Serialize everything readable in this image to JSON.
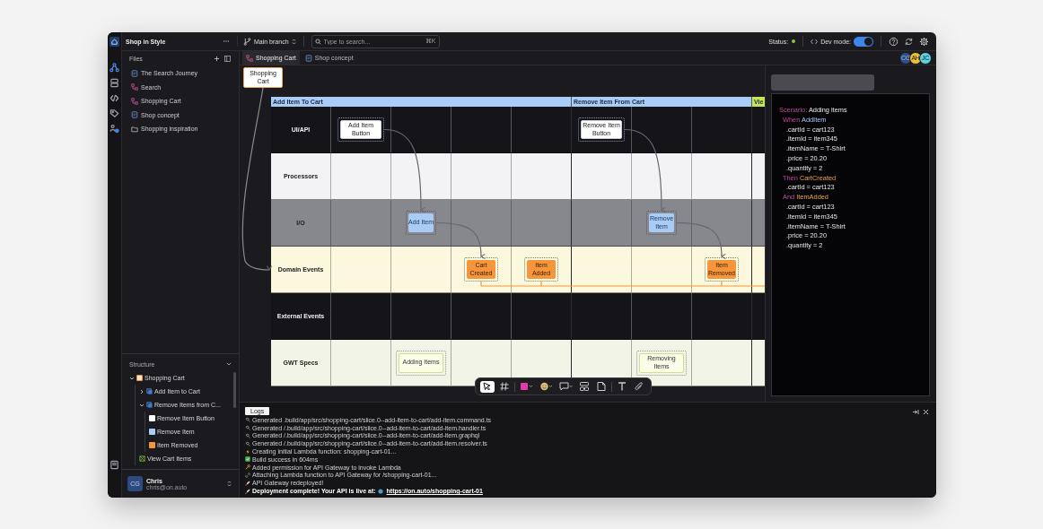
{
  "rail": [
    {
      "kind": "flow",
      "selected": true
    },
    {
      "kind": "database",
      "selected": false
    },
    {
      "kind": "code",
      "selected": false
    },
    {
      "kind": "tags",
      "selected": false
    },
    {
      "kind": "people",
      "selected": false
    },
    {
      "kind": "book",
      "selected": false
    }
  ],
  "project": {
    "name": "Shop in Style"
  },
  "branch": {
    "label": "Main branch"
  },
  "search": {
    "placeholder": "Type to search...",
    "shortcut": "⌘K"
  },
  "status": {
    "label": "Status:",
    "ok": true
  },
  "dev_mode": {
    "label": "Dev mode:",
    "on": true
  },
  "files": {
    "title": "Files",
    "items": [
      {
        "label": "The Search Journey",
        "kind": "doc"
      },
      {
        "label": "Search",
        "kind": "flow"
      },
      {
        "label": "Shopping Cart",
        "kind": "flow"
      },
      {
        "label": "Shop concept",
        "kind": "doc"
      },
      {
        "label": "Shopping inspiration",
        "kind": "folder"
      }
    ]
  },
  "structure": {
    "title": "Structure",
    "tree": [
      {
        "label": "Shopping Cart",
        "kind": "board",
        "expanded": true,
        "children": [
          {
            "label": "Add Item to Cart",
            "kind": "slice",
            "expanded": false
          },
          {
            "label": "Remove Items from C...",
            "kind": "slice",
            "expanded": true,
            "children": [
              {
                "label": "Remove Item Button",
                "kind": "ui"
              },
              {
                "label": "Remove Item",
                "kind": "io"
              },
              {
                "label": "Item Removed",
                "kind": "event"
              }
            ]
          },
          {
            "label": "View Cart Items",
            "kind": "view"
          }
        ]
      }
    ]
  },
  "user": {
    "initials": "CG",
    "name": "Chris",
    "email": "chris@on.auto"
  },
  "tabs": [
    {
      "label": "Shopping Cart",
      "kind": "flow",
      "selected": true
    },
    {
      "label": "Shop concept",
      "kind": "doc",
      "selected": false
    }
  ],
  "collaborators": [
    {
      "initials": "CG",
      "color": "#2f4f86"
    },
    {
      "initials": "AH",
      "color": "#f2c12e"
    },
    {
      "initials": "JC",
      "color": "#5fd3e6"
    }
  ],
  "note": {
    "text": "Shopping Cart"
  },
  "board": {
    "lanes": [
      {
        "label": "UI/API",
        "kind": "ui"
      },
      {
        "label": "Processors",
        "kind": "processor"
      },
      {
        "label": "I/O",
        "kind": "io"
      },
      {
        "label": "Domain Events",
        "kind": "event"
      },
      {
        "label": "External Events",
        "kind": "external"
      },
      {
        "label": "GWT Specs",
        "kind": "spec"
      }
    ],
    "slices": [
      {
        "title": "Add Item To Cart",
        "color": "#a9cdf6",
        "columns": [
          [
            {
              "label": "Add Item Button",
              "kind": "ui"
            }
          ],
          [
            {
              "label": "Add Item",
              "kind": "io"
            },
            {
              "label": "Adding Items",
              "kind": "spec"
            }
          ],
          [
            {
              "label": "Cart Created",
              "kind": "event"
            }
          ],
          [
            {
              "label": "Item Added",
              "kind": "event"
            }
          ]
        ]
      },
      {
        "title": "Remove Item From Cart",
        "color": "#a9cdf6",
        "columns": [
          [
            {
              "label": "Remove Item Button",
              "kind": "ui"
            }
          ],
          [
            {
              "label": "Remove Item",
              "kind": "io"
            },
            {
              "label": "Removing Items",
              "kind": "spec"
            }
          ],
          [
            {
              "label": "Item Removed",
              "kind": "event"
            }
          ]
        ]
      },
      {
        "title": "Vie",
        "color": "#c6e65a"
      }
    ]
  },
  "toolbar": [
    {
      "kind": "pointer",
      "selected": true
    },
    {
      "kind": "hash",
      "selected": false
    },
    {
      "kind": "color",
      "selected": false
    },
    {
      "kind": "face",
      "selected": false
    },
    {
      "kind": "comment",
      "selected": false
    },
    {
      "kind": "layout",
      "selected": false
    },
    {
      "kind": "page",
      "selected": false
    },
    {
      "kind": "text",
      "selected": false
    },
    {
      "kind": "clip",
      "selected": false
    }
  ],
  "spec_panel": {
    "lines": [
      {
        "kind": "scenario",
        "keyword": "Scenario:",
        "text": "Adding items"
      },
      {
        "kind": "when",
        "keyword": "When",
        "text": "AddItem"
      },
      {
        "kind": "field",
        "text": ".cartId = cart123"
      },
      {
        "kind": "field",
        "text": ".itemId = item345"
      },
      {
        "kind": "field",
        "text": ".itemName = T-Shirt"
      },
      {
        "kind": "field",
        "text": ".price = 20.20"
      },
      {
        "kind": "field",
        "text": ".quantity = 2"
      },
      {
        "kind": "then",
        "keyword": "Then",
        "text": "CartCreated"
      },
      {
        "kind": "field",
        "text": ".cartId = cart123"
      },
      {
        "kind": "then",
        "keyword": "And",
        "text": "ItemAdded"
      },
      {
        "kind": "field",
        "text": ".cartId = cart123"
      },
      {
        "kind": "field",
        "text": ".itemId = item345"
      },
      {
        "kind": "field",
        "text": ".itemName = T-Shirt"
      },
      {
        "kind": "field",
        "text": ".price = 20.20"
      },
      {
        "kind": "field",
        "text": ".quantity = 2"
      }
    ]
  },
  "logs": {
    "title": "Logs",
    "lines": [
      {
        "kind": "tool",
        "text": "Generated .build/app/src/shopping-cart/slice.0--add-item-to-cart/add-item.command.ts"
      },
      {
        "kind": "tool",
        "text": "Generated /.build/app/src/shopping-cart/slice.0--add-item-to-cart/add-item.handler.ts"
      },
      {
        "kind": "tool",
        "text": "Generated /.build/app/src/shopping-cart/slice.0--add-item-to-cart/add-item.graphql"
      },
      {
        "kind": "tool",
        "text": "Generated /.build/app/src/shopping-cart/slice.0--add-item-to-cart/add-item.resolver.ts"
      },
      {
        "kind": "bolt",
        "text": "Creating initial Lambda function: shopping-cart-01..."
      },
      {
        "kind": "check",
        "text": "Build success in 604ms"
      },
      {
        "kind": "key",
        "text": "Added permission for API Gateway to invoke Lambda"
      },
      {
        "kind": "link",
        "text": "Attaching Lambda function to API Gateway for /shopping-cart-01..."
      },
      {
        "kind": "rocket",
        "text": "API Gateway redeployed!"
      },
      {
        "kind": "final",
        "text": "Deployment complete! Your API is live at:",
        "link": "https://on.auto/shopping-cart-01"
      }
    ]
  }
}
